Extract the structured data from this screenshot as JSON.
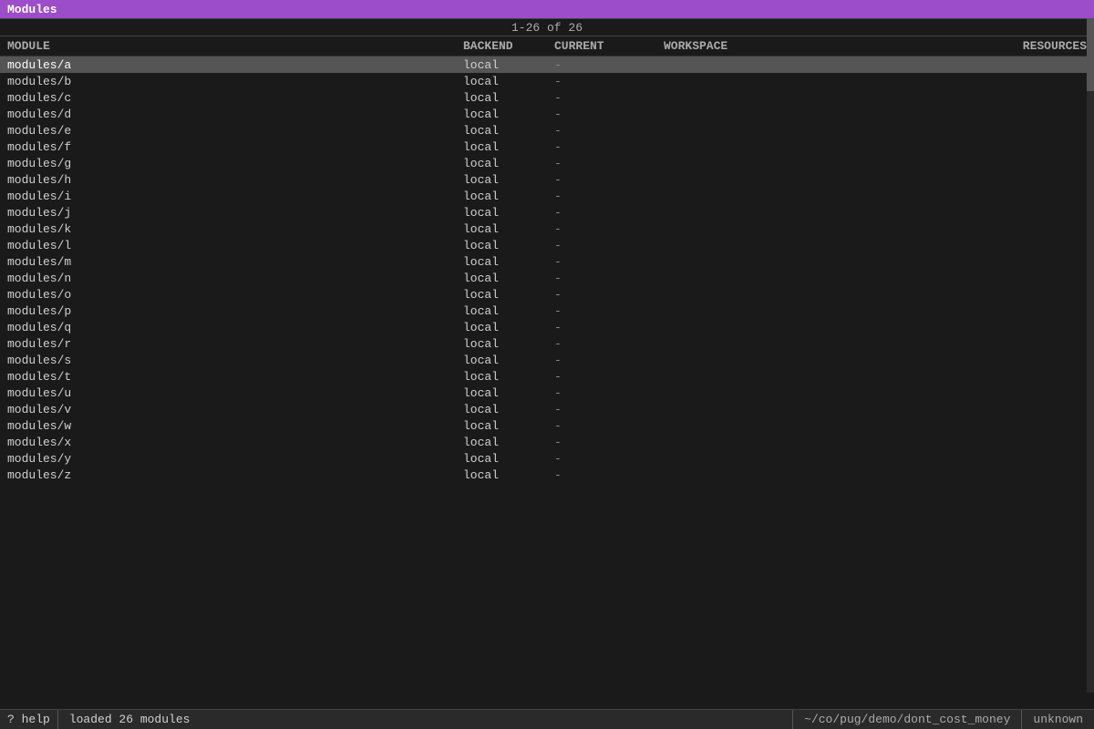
{
  "titleBar": {
    "label": "Modules"
  },
  "pagination": {
    "text": "1-26 of 26"
  },
  "columns": {
    "module": "MODULE",
    "backend": "BACKEND",
    "current": "CURRENT",
    "workspace": "WORKSPACE",
    "resources": "RESOURCES"
  },
  "rows": [
    {
      "module": "modules/a",
      "backend": "local",
      "current": "-",
      "workspace": "",
      "resources": ""
    },
    {
      "module": "modules/b",
      "backend": "local",
      "current": "-",
      "workspace": "",
      "resources": ""
    },
    {
      "module": "modules/c",
      "backend": "local",
      "current": "-",
      "workspace": "",
      "resources": ""
    },
    {
      "module": "modules/d",
      "backend": "local",
      "current": "-",
      "workspace": "",
      "resources": ""
    },
    {
      "module": "modules/e",
      "backend": "local",
      "current": "-",
      "workspace": "",
      "resources": ""
    },
    {
      "module": "modules/f",
      "backend": "local",
      "current": "-",
      "workspace": "",
      "resources": ""
    },
    {
      "module": "modules/g",
      "backend": "local",
      "current": "-",
      "workspace": "",
      "resources": ""
    },
    {
      "module": "modules/h",
      "backend": "local",
      "current": "-",
      "workspace": "",
      "resources": ""
    },
    {
      "module": "modules/i",
      "backend": "local",
      "current": "-",
      "workspace": "",
      "resources": ""
    },
    {
      "module": "modules/j",
      "backend": "local",
      "current": "-",
      "workspace": "",
      "resources": ""
    },
    {
      "module": "modules/k",
      "backend": "local",
      "current": "-",
      "workspace": "",
      "resources": ""
    },
    {
      "module": "modules/l",
      "backend": "local",
      "current": "-",
      "workspace": "",
      "resources": ""
    },
    {
      "module": "modules/m",
      "backend": "local",
      "current": "-",
      "workspace": "",
      "resources": ""
    },
    {
      "module": "modules/n",
      "backend": "local",
      "current": "-",
      "workspace": "",
      "resources": ""
    },
    {
      "module": "modules/o",
      "backend": "local",
      "current": "-",
      "workspace": "",
      "resources": ""
    },
    {
      "module": "modules/p",
      "backend": "local",
      "current": "-",
      "workspace": "",
      "resources": ""
    },
    {
      "module": "modules/q",
      "backend": "local",
      "current": "-",
      "workspace": "",
      "resources": ""
    },
    {
      "module": "modules/r",
      "backend": "local",
      "current": "-",
      "workspace": "",
      "resources": ""
    },
    {
      "module": "modules/s",
      "backend": "local",
      "current": "-",
      "workspace": "",
      "resources": ""
    },
    {
      "module": "modules/t",
      "backend": "local",
      "current": "-",
      "workspace": "",
      "resources": ""
    },
    {
      "module": "modules/u",
      "backend": "local",
      "current": "-",
      "workspace": "",
      "resources": ""
    },
    {
      "module": "modules/v",
      "backend": "local",
      "current": "-",
      "workspace": "",
      "resources": ""
    },
    {
      "module": "modules/w",
      "backend": "local",
      "current": "-",
      "workspace": "",
      "resources": ""
    },
    {
      "module": "modules/x",
      "backend": "local",
      "current": "-",
      "workspace": "",
      "resources": ""
    },
    {
      "module": "modules/y",
      "backend": "local",
      "current": "-",
      "workspace": "",
      "resources": ""
    },
    {
      "module": "modules/z",
      "backend": "local",
      "current": "-",
      "workspace": "",
      "resources": ""
    }
  ],
  "statusBar": {
    "helpLabel": "? help",
    "message": "loaded 26 modules",
    "path": "~/co/pug/demo/dont_cost_money",
    "version": "unknown"
  }
}
